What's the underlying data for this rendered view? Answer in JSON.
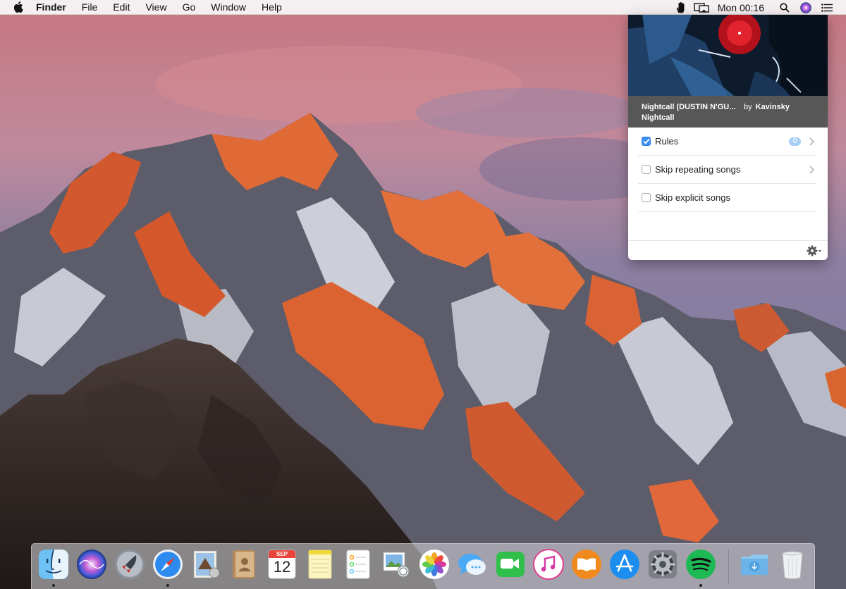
{
  "menubar": {
    "app_name": "Finder",
    "menus": [
      "File",
      "Edit",
      "View",
      "Go",
      "Window",
      "Help"
    ],
    "clock": "Mon 00:16"
  },
  "panel": {
    "track_title": "Nightcall (DUSTIN N'GU...",
    "by_label": "by",
    "artist": "Kavinsky",
    "album": "Nightcall",
    "options": [
      {
        "label": "Rules",
        "checked": true,
        "badge": "0",
        "chevron": true
      },
      {
        "label": "Skip repeating songs",
        "checked": false,
        "chevron": true
      },
      {
        "label": "Skip explicit songs",
        "checked": false,
        "chevron": false
      }
    ]
  },
  "dock": {
    "calendar_month": "SEP",
    "calendar_day": "12"
  },
  "colors": {
    "accent": "#3b8ff5",
    "badge": "#a7cef5",
    "track_bar": "#575757"
  }
}
